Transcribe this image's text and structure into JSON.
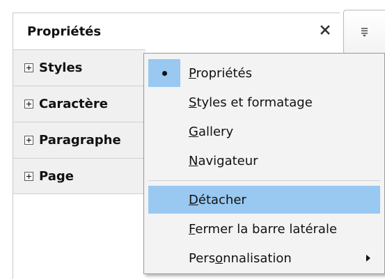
{
  "panel": {
    "title": "Propriétés",
    "sections": [
      "Styles",
      "Caractère",
      "Paragraphe",
      "Page"
    ]
  },
  "icons": {
    "close": "close-icon",
    "expand": "plus-box-icon",
    "menu": "sidebar-menu-icon",
    "selected": "radio-dot-icon",
    "submenu": "submenu-arrow-icon"
  },
  "menu": {
    "items": [
      {
        "pre": "",
        "key": "P",
        "post": "ropriétés"
      },
      {
        "pre": "",
        "key": "S",
        "post": "tyles et formatage"
      },
      {
        "pre": "",
        "key": "G",
        "post": "allery"
      },
      {
        "pre": "",
        "key": "N",
        "post": "avigateur"
      },
      {
        "pre": "",
        "key": "D",
        "post": "étacher"
      },
      {
        "pre": "",
        "key": "F",
        "post": "ermer la barre latérale"
      },
      {
        "pre": "Pers",
        "key": "o",
        "post": "nnalisation"
      }
    ]
  },
  "colors": {
    "highlight": "#99c8f0",
    "menu_bg": "#f3f3f3",
    "section_bg": "#f0f0f0"
  }
}
